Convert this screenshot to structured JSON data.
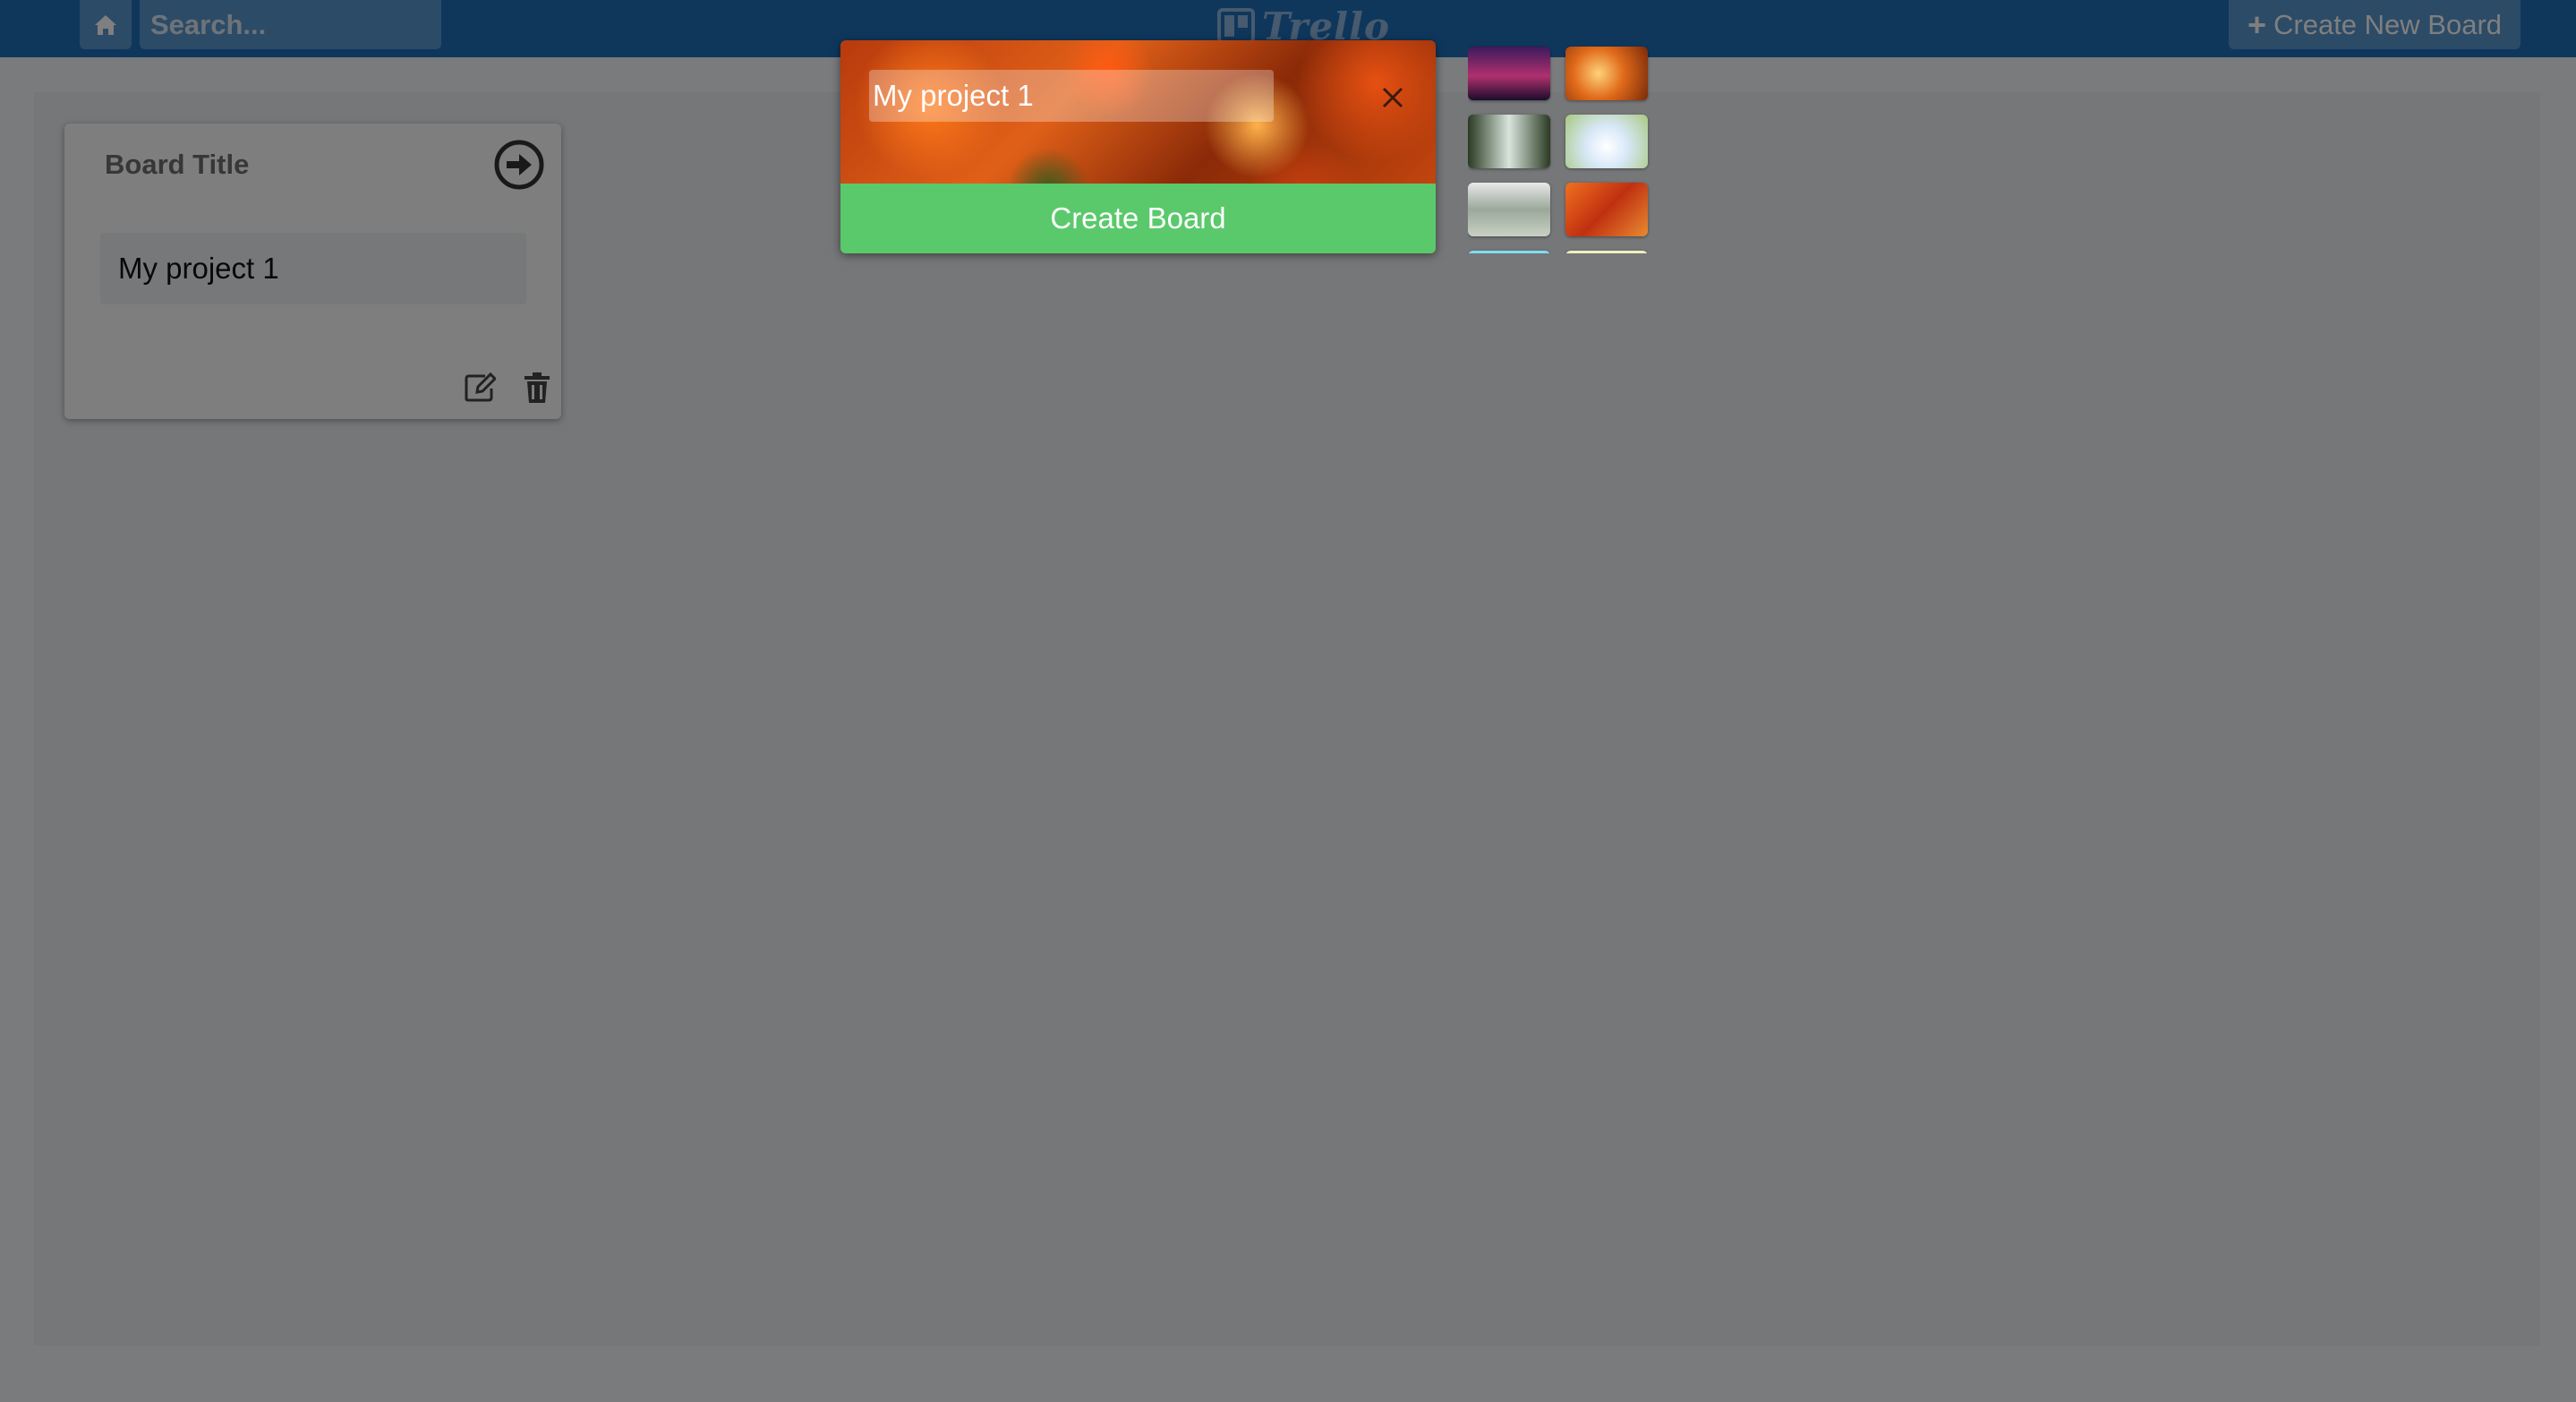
{
  "navbar": {
    "search_placeholder": "Search...",
    "logo_text": "Trello",
    "create_new_board_label": "Create New Board",
    "color": "#1e6fb8"
  },
  "board_card": {
    "heading": "Board Title",
    "board_name": "My project 1"
  },
  "create_board_popup": {
    "title_value": "My project 1",
    "create_button_label": "Create Board",
    "button_color": "#5ac96b"
  },
  "background_thumbnails": [
    "sunset-tree",
    "autumn-road",
    "misty-forest",
    "white-flowers",
    "snowy-stream",
    "autumn-leaves",
    "turquoise-water",
    "meadow"
  ]
}
